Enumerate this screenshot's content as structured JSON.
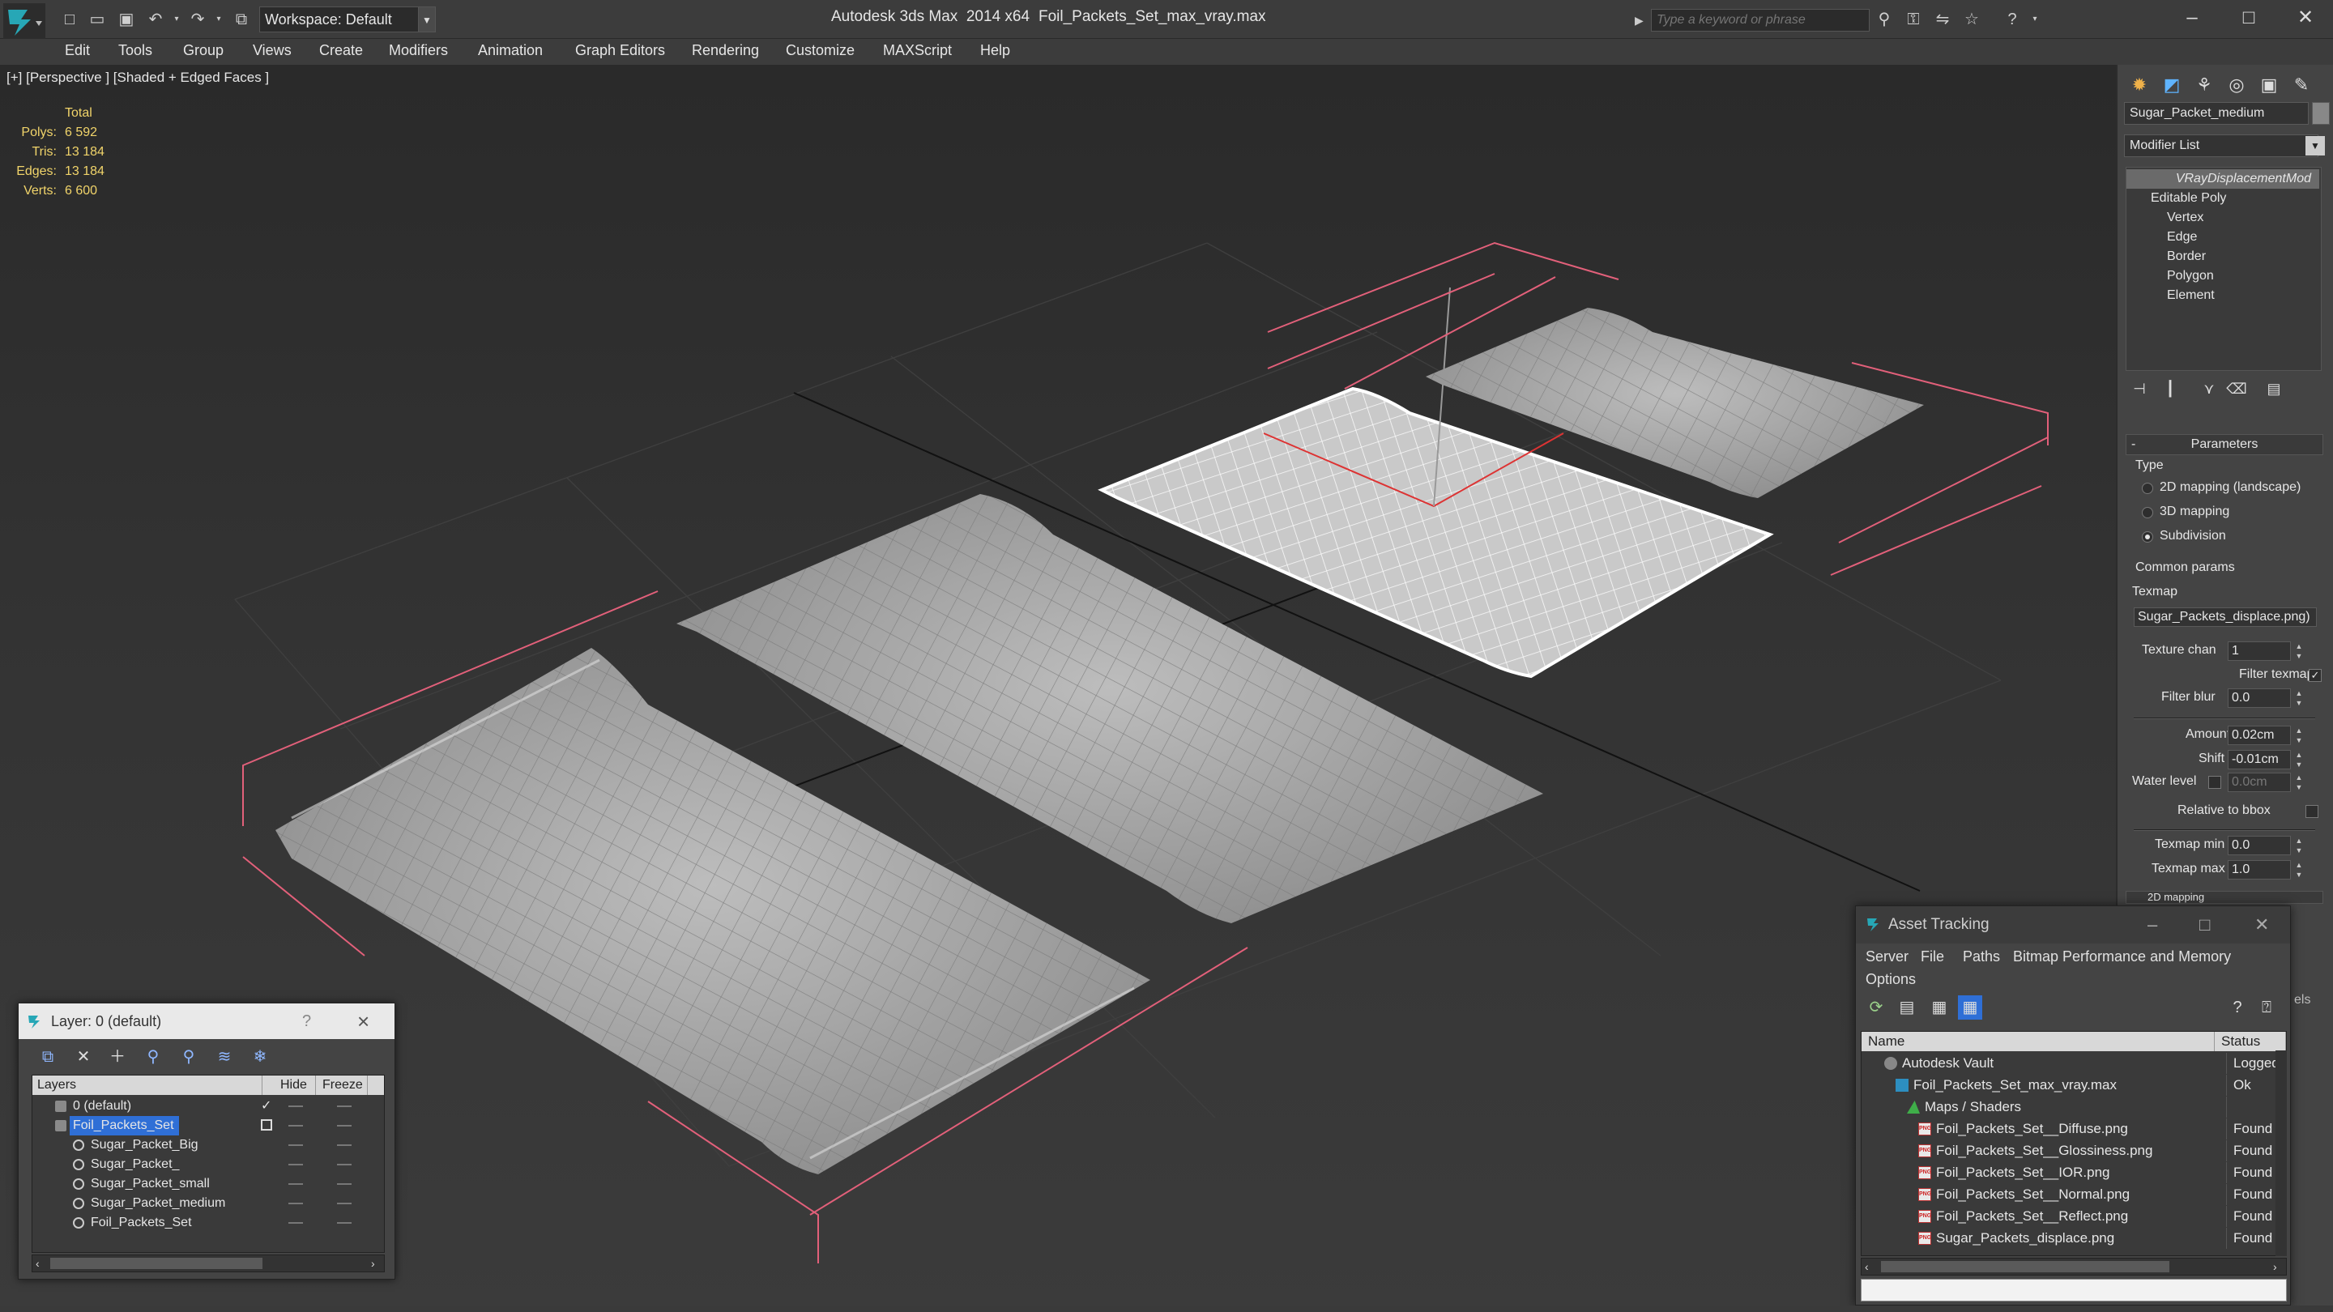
{
  "titlebar": {
    "workspace": "Workspace: Default",
    "app_title": "Autodesk 3ds Max  2014 x64",
    "file_title": "Foil_Packets_Set_max_vray.max",
    "search_placeholder": "Type a keyword or phrase"
  },
  "menu": [
    "Edit",
    "Tools",
    "Group",
    "Views",
    "Create",
    "Modifiers",
    "Animation",
    "Graph Editors",
    "Rendering",
    "Customize",
    "MAXScript",
    "Help"
  ],
  "viewport": {
    "label": "[+] [Perspective ] [Shaded + Edged Faces ]",
    "stats_header": "Total",
    "stats": [
      {
        "k": "Polys:",
        "v": "6 592"
      },
      {
        "k": "Tris:",
        "v": "13 184"
      },
      {
        "k": "Edges:",
        "v": "13 184"
      },
      {
        "k": "Verts:",
        "v": "6 600"
      }
    ]
  },
  "command_panel": {
    "object_name": "Sugar_Packet_medium",
    "modifier_list": "Modifier List",
    "stack": {
      "top": "VRayDisplacementMod",
      "base": "Editable Poly",
      "subs": [
        "Vertex",
        "Edge",
        "Border",
        "Polygon",
        "Element"
      ]
    },
    "parameters": {
      "rollout_title": "Parameters",
      "type_label": "Type",
      "type_options": [
        "2D mapping (landscape)",
        "3D mapping",
        "Subdivision"
      ],
      "type_selected": "Subdivision",
      "common_label": "Common params",
      "texmap_label": "Texmap",
      "texmap_value": "Sugar_Packets_displace.png)",
      "texture_chan_label": "Texture chan",
      "texture_chan": "1",
      "filter_texmap_label": "Filter texmap",
      "filter_blur_label": "Filter blur",
      "filter_blur": "0.0",
      "amount_label": "Amount",
      "amount": "0.02cm",
      "shift_label": "Shift",
      "shift": "-0.01cm",
      "water_level_label": "Water level",
      "water_level": "0.0cm",
      "relative_bbox_label": "Relative to bbox",
      "texmap_min_label": "Texmap min",
      "texmap_min": "0.0",
      "texmap_max_label": "Texmap max",
      "texmap_max": "1.0",
      "next_rollout": "2D mapping"
    }
  },
  "layer_dialog": {
    "title": "Layer: 0 (default)",
    "help": "?",
    "col_layers": "Layers",
    "col_hide": "Hide",
    "col_freeze": "Freeze",
    "rows": [
      {
        "name": "0 (default)",
        "indent": 0
      },
      {
        "name": "Foil_Packets_Set",
        "indent": 0
      },
      {
        "name": "Sugar_Packet_Big",
        "indent": 1
      },
      {
        "name": "Sugar_Packet_",
        "indent": 1
      },
      {
        "name": "Sugar_Packet_small",
        "indent": 1
      },
      {
        "name": "Sugar_Packet_medium",
        "indent": 1
      },
      {
        "name": "Foil_Packets_Set",
        "indent": 1
      }
    ]
  },
  "asset_dialog": {
    "title": "Asset Tracking",
    "menus": [
      "Server",
      "File",
      "Paths",
      "Bitmap Performance and Memory",
      "Options"
    ],
    "col_name": "Name",
    "col_status": "Status",
    "side_label": "els",
    "rows": [
      {
        "name": "Autodesk Vault",
        "status": "Logged O",
        "indent": 1
      },
      {
        "name": "Foil_Packets_Set_max_vray.max",
        "status": "Ok",
        "indent": 2
      },
      {
        "name": "Maps / Shaders",
        "status": "",
        "indent": 3
      },
      {
        "name": "Foil_Packets_Set__Diffuse.png",
        "status": "Found",
        "indent": 4
      },
      {
        "name": "Foil_Packets_Set__Glossiness.png",
        "status": "Found",
        "indent": 4
      },
      {
        "name": "Foil_Packets_Set__IOR.png",
        "status": "Found",
        "indent": 4
      },
      {
        "name": "Foil_Packets_Set__Normal.png",
        "status": "Found",
        "indent": 4
      },
      {
        "name": "Foil_Packets_Set__Reflect.png",
        "status": "Found",
        "indent": 4
      },
      {
        "name": "Sugar_Packets_displace.png",
        "status": "Found",
        "indent": 4
      }
    ]
  },
  "colors": {
    "accent": "#2f6fd6",
    "stats_yellow": "#f1d46a",
    "bbox_red": "#e2607a",
    "mesh_grey": "#a9a9a9",
    "selected_wire": "#ffffff"
  }
}
